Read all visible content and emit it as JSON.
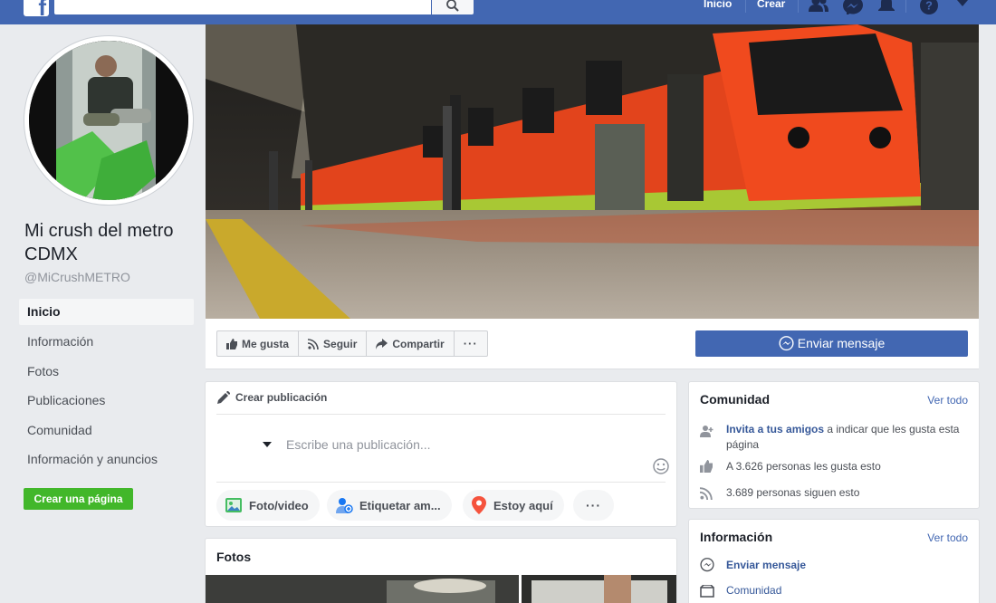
{
  "topbar": {
    "logo": "f",
    "search_placeholder": "",
    "nav": {
      "home": "Inicio",
      "create": "Crear"
    },
    "icons": [
      "friends-icon",
      "messenger-icon",
      "notifications-icon",
      "help-icon",
      "caret-down-icon"
    ]
  },
  "page": {
    "name": "Mi crush del metro CDMX",
    "handle": "@MiCrushMETRO"
  },
  "sidebar": {
    "items": [
      {
        "label": "Inicio",
        "active": true
      },
      {
        "label": "Información"
      },
      {
        "label": "Fotos"
      },
      {
        "label": "Publicaciones"
      },
      {
        "label": "Comunidad"
      },
      {
        "label": "Información y anuncios"
      }
    ],
    "create_page": "Crear una página"
  },
  "actions": {
    "like": "Me gusta",
    "follow": "Seguir",
    "share": "Compartir",
    "more": "···",
    "send_message": "Enviar mensaje"
  },
  "composer": {
    "title": "Crear publicación",
    "placeholder": "Escribe una publicación...",
    "buttons": [
      "Foto/video",
      "Etiquetar am...",
      "Estoy aquí",
      "···"
    ]
  },
  "photos": {
    "title": "Fotos"
  },
  "community": {
    "title": "Comunidad",
    "see_all": "Ver todo",
    "invite_link": "Invita a tus amigos",
    "invite_rest": " a indicar que les gusta esta página",
    "likes": "A 3.626 personas les gusta esto",
    "followers": "3.689 personas siguen esto"
  },
  "about": {
    "title": "Información",
    "see_all": "Ver todo",
    "send_message": "Enviar mensaje",
    "community": "Comunidad"
  },
  "colors": {
    "brand": "#4267b2",
    "create_green": "#42b72a",
    "background": "#e9ebee"
  }
}
